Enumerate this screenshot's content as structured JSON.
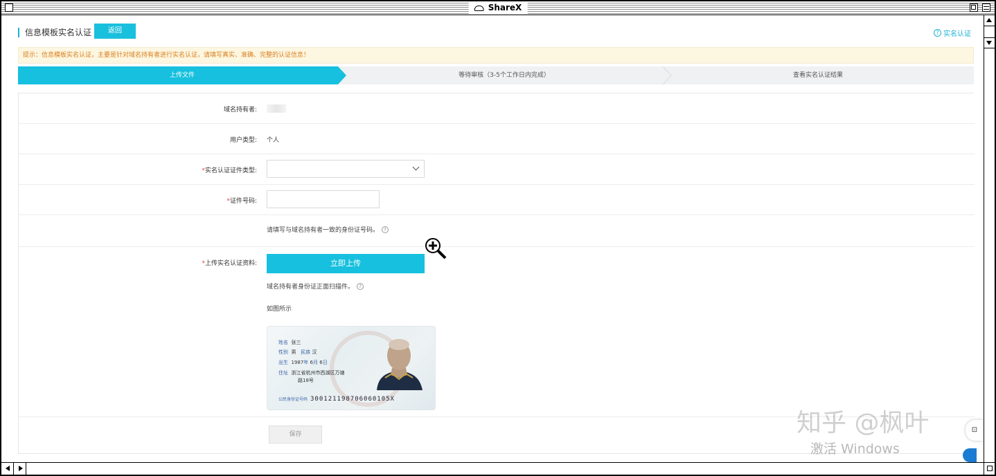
{
  "window": {
    "title": "ShareX"
  },
  "header": {
    "title": "信息模板实名认证",
    "back_label": "返回",
    "help_label": "实名认证"
  },
  "notice": "提示：信息模板实名认证，主要是针对域名持有者进行实名认证，请填写真实、准确、完整的认证信息！",
  "steps": [
    {
      "label": "上传文件",
      "active": true
    },
    {
      "label": "等待审核（3-5个工作日内完成）",
      "active": false
    },
    {
      "label": "查看实名认证结果",
      "active": false
    }
  ],
  "form": {
    "holder_label": "域名持有者:",
    "user_type_label": "用户类型:",
    "user_type_value": "个人",
    "doc_type_label": "实名认证证件类型:",
    "doc_type_value": "",
    "doc_number_label": "证件号码:",
    "doc_number_value": "",
    "doc_number_hint": "请填写与域名持有者一致的身份证号码。",
    "upload_label": "上传实名认证资料:",
    "upload_button": "立即上传",
    "upload_hint": "域名持有者身份证正面扫描件。",
    "example_label": "如图所示",
    "required_mark": "*",
    "save_button": "保存"
  },
  "id_card": {
    "name_key": "姓名",
    "name_val": "张三",
    "sex_key": "性别",
    "sex_val": "男",
    "ethnic_key": "民族",
    "ethnic_val": "汉",
    "birth_key": "出生",
    "birth_year": "1987",
    "birth_month": "6",
    "birth_day": "6",
    "birth_y_unit": "年",
    "birth_m_unit": "月",
    "birth_d_unit": "日",
    "addr_key": "住址",
    "addr_line1": "浙江省杭州市西湖区万塘",
    "addr_line2": "路18号",
    "num_key": "公民身份证号码",
    "num_val": "300121198706060105X"
  },
  "overlays": {
    "watermark": "知乎 @枫叶",
    "activation": "激活 Windows",
    "float_label": "⊡"
  },
  "colors": {
    "accent": "#17c0de",
    "notice_text": "#d8801f",
    "required": "#e64343"
  }
}
